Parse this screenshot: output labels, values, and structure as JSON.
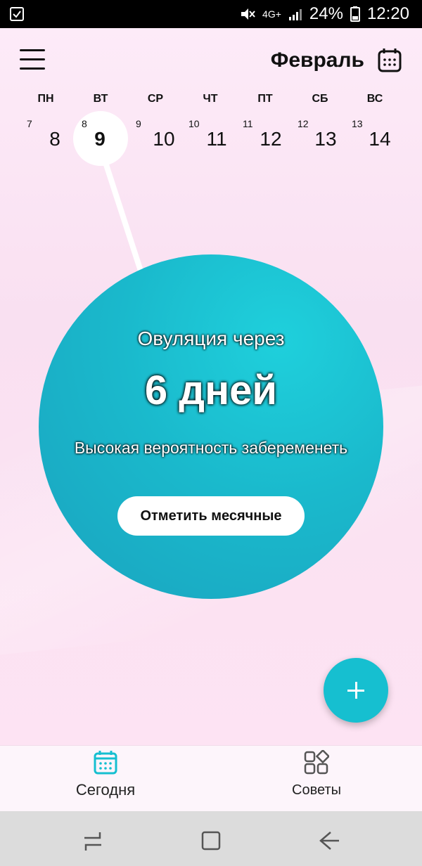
{
  "status_bar": {
    "signal_label": "4G+",
    "battery": "24%",
    "time": "12:20"
  },
  "header": {
    "month": "Февраль"
  },
  "week": {
    "weekday_labels": [
      "ПН",
      "ВТ",
      "СР",
      "ЧТ",
      "ПТ",
      "СБ",
      "ВС"
    ],
    "days": [
      {
        "small": "7",
        "num": "8"
      },
      {
        "small": "8",
        "num": "9"
      },
      {
        "small": "9",
        "num": "10"
      },
      {
        "small": "10",
        "num": "11"
      },
      {
        "small": "11",
        "num": "12"
      },
      {
        "small": "12",
        "num": "13"
      },
      {
        "small": "13",
        "num": "14"
      }
    ],
    "selected_index": 1
  },
  "status_circle": {
    "line1": "Овуляция через",
    "line2": "6 дней",
    "line3": "Высокая вероятность забеременеть",
    "button": "Отметить месячные",
    "accent_color": "#1ab9cc"
  },
  "fab": {
    "icon": "plus-icon"
  },
  "bottom_nav": {
    "today": "Сегодня",
    "tips": "Советы"
  },
  "android_nav": {
    "recent": "recent-apps-icon",
    "home": "home-icon",
    "back": "back-icon"
  }
}
